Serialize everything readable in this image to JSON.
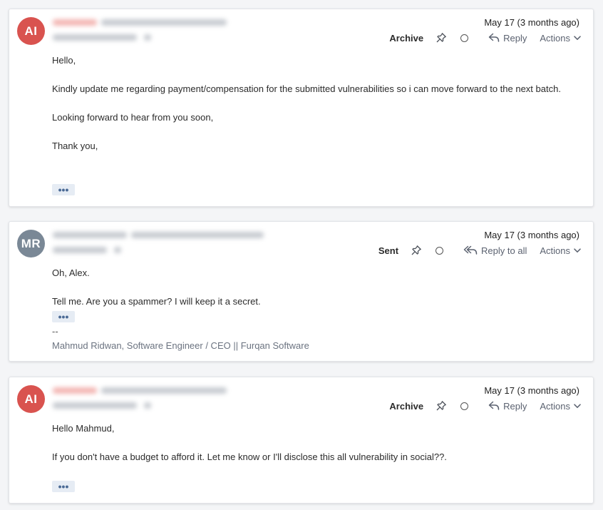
{
  "colors": {
    "avatar_ai": "#d9534f",
    "avatar_mr": "#7a8896",
    "blur_red": "#f3b6b3",
    "blur_gray": "#c7cbd1"
  },
  "icons": {
    "reply": "reply-icon",
    "reply_all": "reply-all-icon",
    "pin": "pin-icon",
    "status": "circle-icon",
    "chevron": "chevron-down-icon"
  },
  "messages": [
    {
      "avatar": "AI",
      "date": "May 17 (3 months ago)",
      "status": "Archive",
      "reply_label": "Reply",
      "actions_label": "Actions",
      "paragraphs": [
        "Hello,",
        "Kindly update me regarding payment/compensation for the submitted vulnerabilities so i can move forward to the next batch.",
        "Looking forward to hear from you soon,",
        "Thank you,"
      ],
      "more_label": "•••"
    },
    {
      "avatar": "MR",
      "date": "May 17 (3 months ago)",
      "status": "Sent",
      "reply_label": "Reply to all",
      "actions_label": "Actions",
      "paragraphs": [
        "Oh, Alex.",
        "Tell me. Are you a spammer? I will keep it a secret."
      ],
      "more_label": "•••",
      "signature_dash": "--",
      "signature": "Mahmud Ridwan, Software Engineer / CEO || Furqan Software"
    },
    {
      "avatar": "AI",
      "date": "May 17 (3 months ago)",
      "status": "Archive",
      "reply_label": "Reply",
      "actions_label": "Actions",
      "paragraphs": [
        "Hello Mahmud,",
        "If you don't have a budget to afford it. Let me know or I'll disclose this all vulnerability in social??."
      ],
      "more_label": "•••"
    }
  ]
}
